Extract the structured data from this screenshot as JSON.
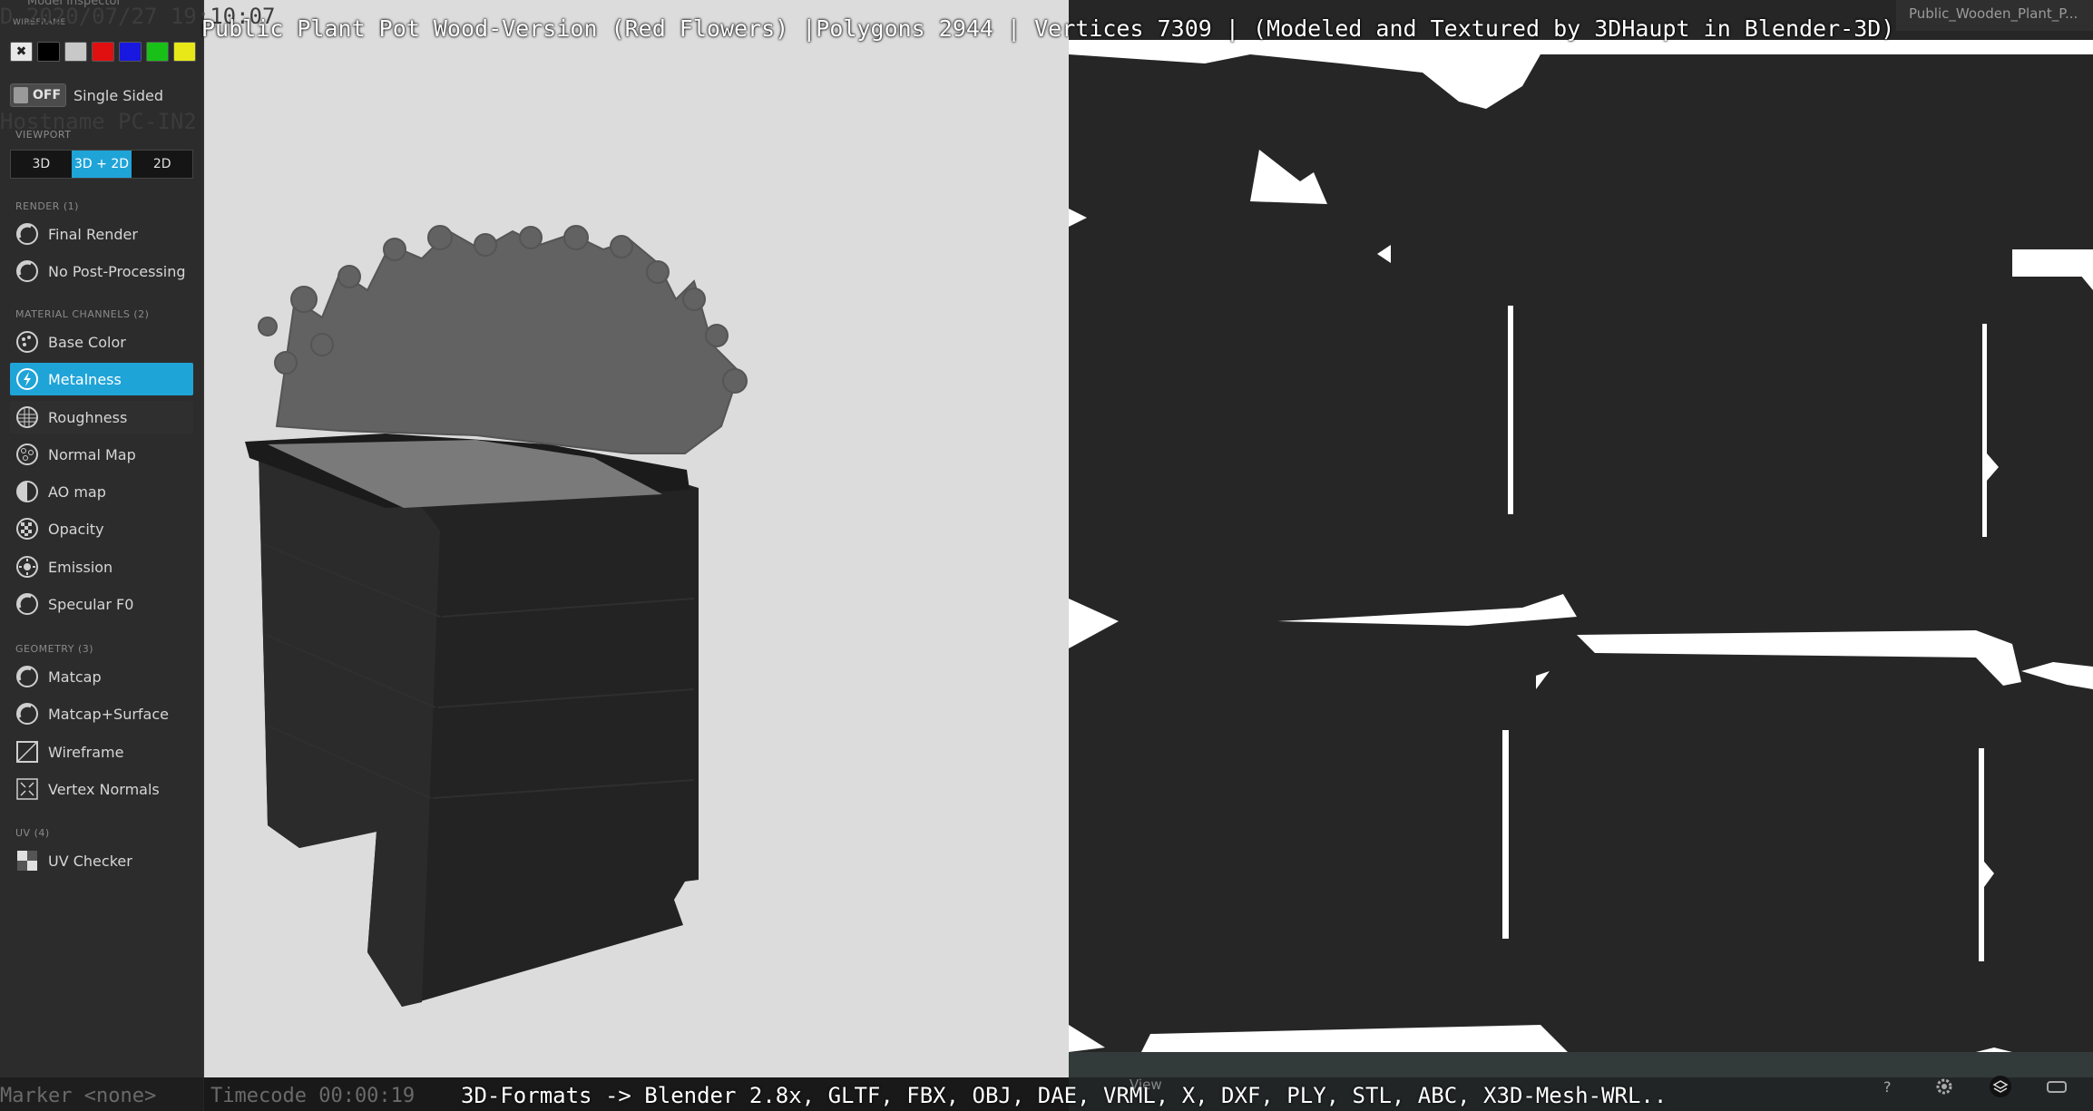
{
  "overlay": {
    "title": "Public Plant Pot Wood-Version (Red Flowers) |Polygons 2944 | Vertices 7309 | (Modeled and Textured by 3DHaupt in Blender-3D)",
    "formats": "3D-Formats -> Blender 2.8x, GLTF, FBX, OBJ, DAE, VRML, X, DXF, PLY, STL, ABC, X3D-Mesh-WRL..",
    "model_name": "Public_Wooden_Plant_P...",
    "ghost_header": "Model Inspector",
    "ghost_date": "D 2020/07/27 19:10:07",
    "ghost_hostname": "Hostname PC-IN2",
    "ghost_marker": "Marker <none>",
    "ghost_timecode": "Timecode 00:00:19",
    "ghost_view": "View"
  },
  "sidebar": {
    "wireframe_label": "WIREFRAME",
    "wireframe_colors": [
      "#000000",
      "#c8c8c8",
      "#e01010",
      "#1818e0",
      "#18c018",
      "#e8e818"
    ],
    "single_sided": {
      "state": "OFF",
      "label": "Single Sided"
    },
    "viewport": {
      "label": "VIEWPORT",
      "options": [
        "3D",
        "3D + 2D",
        "2D"
      ],
      "selected": "3D + 2D"
    },
    "render": {
      "label": "RENDER (1)",
      "items": [
        {
          "label": "Final Render",
          "icon": "sphere-icon"
        },
        {
          "label": "No Post-Processing",
          "icon": "sphere-icon"
        }
      ]
    },
    "material": {
      "label": "MATERIAL CHANNELS (2)",
      "items": [
        {
          "label": "Base Color",
          "icon": "palette-icon"
        },
        {
          "label": "Metalness",
          "icon": "metalness-icon",
          "active": true
        },
        {
          "label": "Roughness",
          "icon": "roughness-icon"
        },
        {
          "label": "Normal Map",
          "icon": "normal-map-icon"
        },
        {
          "label": "AO map",
          "icon": "ao-map-icon"
        },
        {
          "label": "Opacity",
          "icon": "opacity-icon"
        },
        {
          "label": "Emission",
          "icon": "emission-icon"
        },
        {
          "label": "Specular F0",
          "icon": "specular-icon"
        }
      ]
    },
    "geometry": {
      "label": "GEOMETRY (3)",
      "items": [
        {
          "label": "Matcap",
          "icon": "matcap-icon"
        },
        {
          "label": "Matcap+Surface",
          "icon": "matcap-surface-icon"
        },
        {
          "label": "Wireframe",
          "icon": "wireframe-icon"
        },
        {
          "label": "Vertex Normals",
          "icon": "vertex-normals-icon"
        }
      ]
    },
    "uv": {
      "label": "UV (4)",
      "items": [
        {
          "label": "UV Checker",
          "icon": "uv-checker-icon"
        }
      ]
    }
  },
  "colors": {
    "accent": "#1fa4d8",
    "sidebar_bg": "#2c2c2c",
    "viewport3d_bg": "#dcdcdc",
    "uv_bg": "#262626"
  },
  "bottom_icons": [
    "help-icon",
    "settings-icon",
    "layers-icon",
    "vr-icon",
    "fullscreen-icon"
  ]
}
